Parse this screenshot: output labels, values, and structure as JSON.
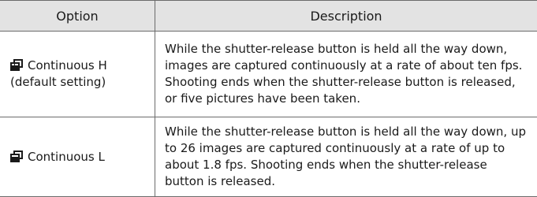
{
  "table": {
    "headers": {
      "option": "Option",
      "description": "Description"
    },
    "rows": [
      {
        "icon": "continuous-h-icon",
        "option_line1": "Continuous H",
        "option_line2": "(default setting)",
        "description": "While the shutter-release button is held all the way down, images are captured continuously at a rate of about ten fps. Shooting ends when the shutter-release button is released, or five pictures have been taken."
      },
      {
        "icon": "continuous-l-icon",
        "option_line1": "Continuous L",
        "description": "While the shutter-release button is held all the way down, up to 26 images are captured continuously at a rate of up to about 1.8 fps. Shooting ends when the shutter-release button is released."
      }
    ]
  }
}
